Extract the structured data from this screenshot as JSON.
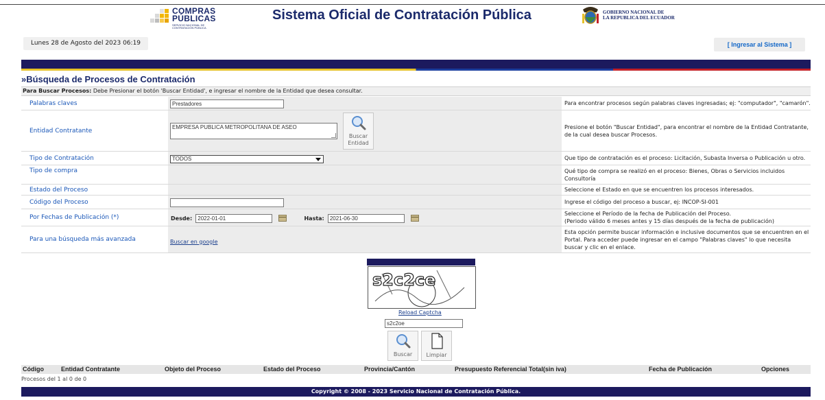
{
  "header": {
    "logo_line1": "COMPRAS",
    "logo_line2": "PÚBLICAS",
    "logo_tagline": "SERVICIO NACIONAL DE CONTRATACIÓN PÚBLICA",
    "title": "Sistema Oficial de Contratación Pública",
    "gov_line1": "GOBIERNO NACIONAL DE",
    "gov_line2": "LA REPUBLICA DEL ECUADOR",
    "date": "Lunes 28 de Agosto del 2023 06:19",
    "login": "[ Ingresar al Sistema ]"
  },
  "section": {
    "title": "»Búsqueda de Procesos de Contratación",
    "instruction_bold": "Para Buscar Procesos:",
    "instruction_text": " Debe Presionar el botón 'Buscar Entidad', e ingresar el nombre de la Entidad que desea consultar."
  },
  "form": {
    "keywords": {
      "label": "Palabras claves",
      "value": "Prestadores",
      "help": "Para encontrar procesos según palabras claves ingresadas; ej: \"computador\", \"camarón\"."
    },
    "entity": {
      "label": "Entidad Contratante",
      "value": "EMPRESA PUBLICA METROPOLITANA DE ASEO",
      "button_line1": "Buscar",
      "button_line2": "Entidad",
      "help": "Presione el botón \"Buscar Entidad\", para encontrar el nombre de la Entidad Contratante, de la cual desea buscar Procesos."
    },
    "contract_type": {
      "label": "Tipo de Contratación",
      "value": "TODOS",
      "help": "Que tipo de contratación es el proceso: Licitación, Subasta Inversa o Publicación u otro."
    },
    "purchase_type": {
      "label": "Tipo de compra",
      "help": "Qué tipo de compra se realizó en el proceso: Bienes, Obras o Servicios incluidos Consultoría"
    },
    "status": {
      "label": "Estado del Proceso",
      "help": "Seleccione el Estado en que se encuentren los procesos interesados."
    },
    "code": {
      "label": "Código del Proceso",
      "value": "",
      "help": "Ingrese el código del proceso a buscar, ej: INCOP-SI-001"
    },
    "dates": {
      "label": "Por Fechas de Publicación (*)",
      "from_label": "Desde:",
      "from_value": "2022-01-01",
      "to_label": "Hasta:",
      "to_value": "2021-06-30",
      "help_line1": "Seleccione el Período de la fecha de Publicación del Proceso.",
      "help_line2": "(Periodo válido 6 meses antes y 15 días después de la fecha de publicación)"
    },
    "advanced": {
      "label": "Para una búsqueda más avanzada",
      "link": "Buscar en google",
      "help": "Esta opción permite buscar información e inclusive documentos que se encuentren en el Portal. Para acceder puede ingresar en el campo \"Palabras claves\" lo que necesita buscar y clic en el enlace."
    }
  },
  "captcha": {
    "image_text": "s2c2ce",
    "reload": "Reload Captcha",
    "value": "s2c2oe",
    "search_button": "Buscar",
    "clear_button": "Limpiar"
  },
  "results": {
    "columns": [
      "Código",
      "Entidad Contratante",
      "Objeto del Proceso",
      "Estado del Proceso",
      "Provincia/Cantón",
      "Presupuesto Referencial Total(sin iva)",
      "Fecha de Publicación",
      "Opciones"
    ],
    "count": "Procesos del 1 al 0 de 0"
  },
  "footer": "Copyright © 2008 - 2023 Servicio Nacional de Contratación Pública.",
  "colors": {
    "navy": "#1c1a5e",
    "title_blue": "#1b2a6b",
    "link_blue": "#1a57b8",
    "login_blue": "#1468c8"
  }
}
